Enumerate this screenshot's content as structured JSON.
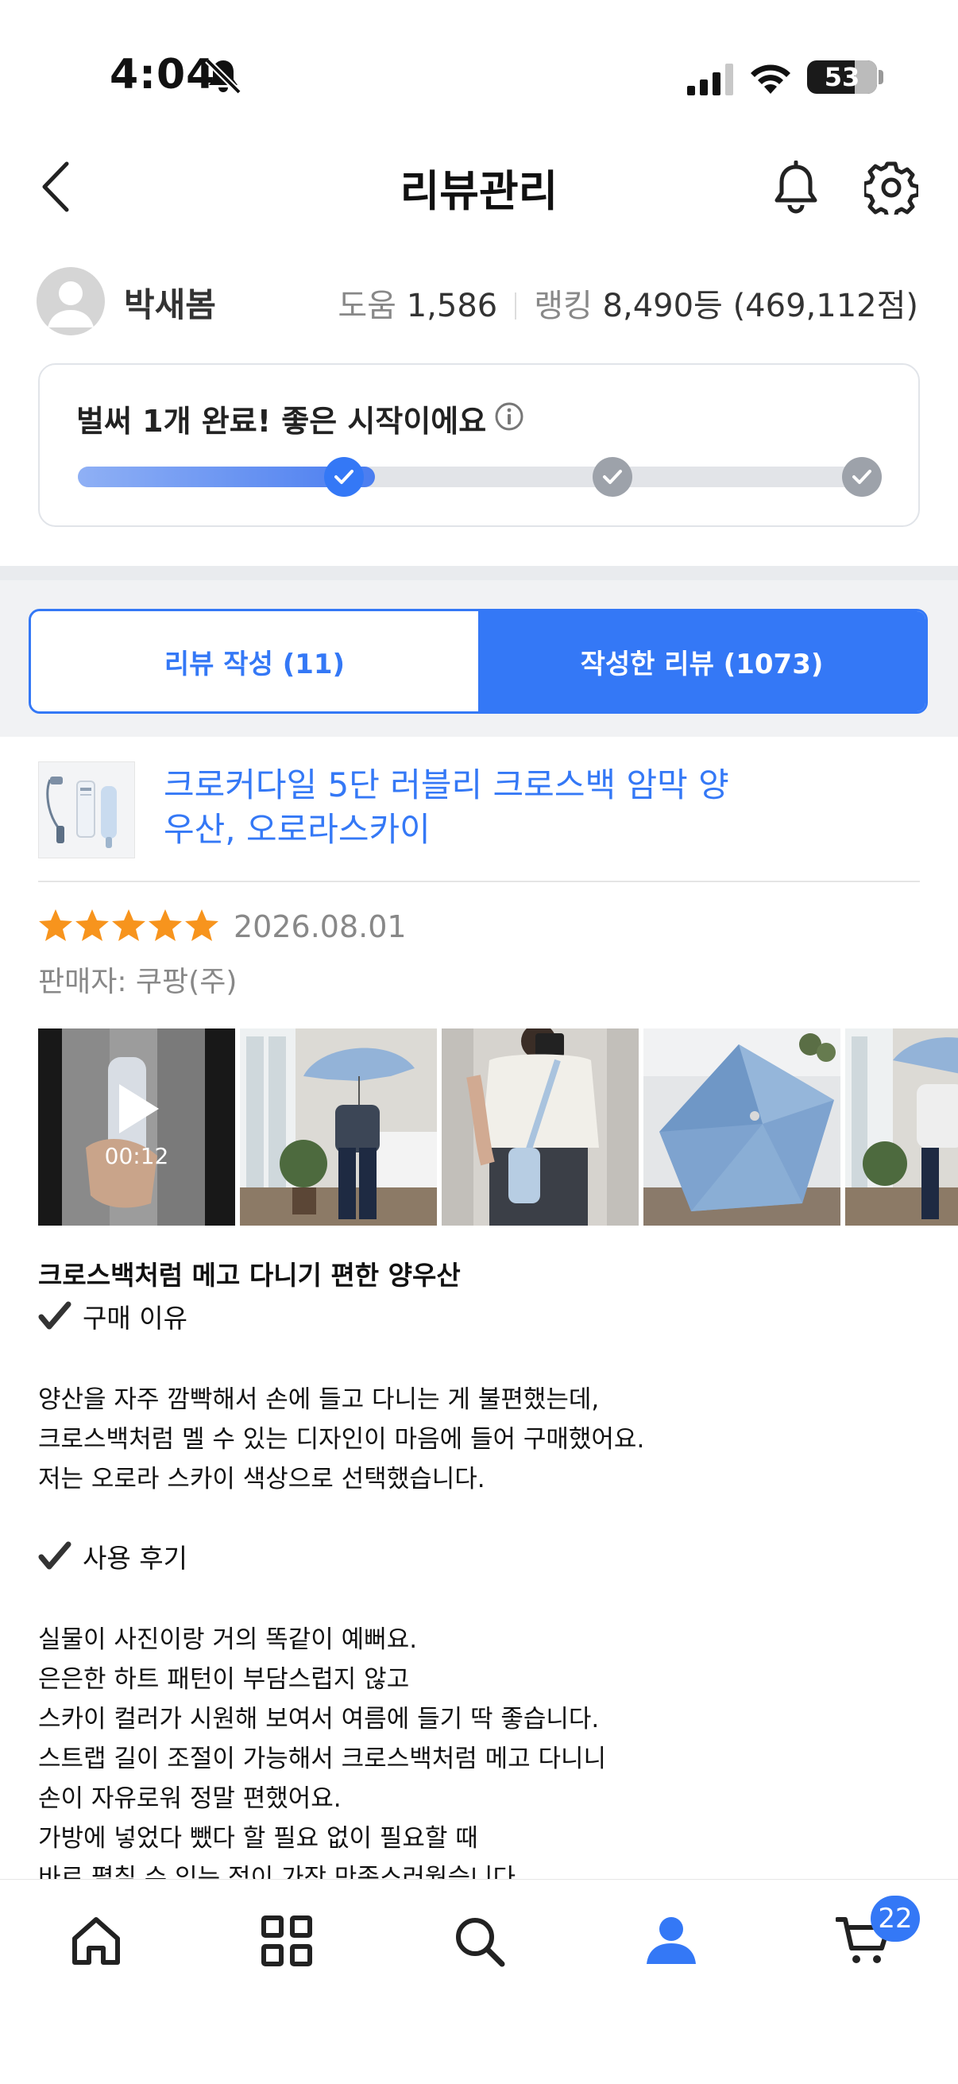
{
  "status_bar": {
    "time": "4:04",
    "battery": "53"
  },
  "header": {
    "title": "리뷰관리"
  },
  "profile": {
    "name": "박새봄",
    "help_label": "도움",
    "help_count": "1,586",
    "rank_label": "랭킹",
    "rank_value": "8,490등 (469,112점)"
  },
  "progress": {
    "message": "벌써 1개 완료! 좋은 시작이에요",
    "completed_steps": 1,
    "total_steps": 3,
    "fill_fraction": 0.37
  },
  "tabs": {
    "write": "리뷰 작성 (11)",
    "written": "작성한 리뷰 (1073)",
    "active": "written"
  },
  "review": {
    "product_name": "크로커다일 5단 러블리 크로스백 암막 양우산, 오로라스카이",
    "rating": 5,
    "date": "2026.08.01",
    "seller": "판매자: 쿠팡(주)",
    "video_duration": "00:12",
    "title": "크로스백처럼 메고 다니기 편한 양우산",
    "section1_heading": "구매 이유",
    "section1_lines": [
      "양산을 자주 깜빡해서 손에 들고 다니는 게 불편했는데,",
      "크로스백처럼 멜 수 있는 디자인이 마음에 들어 구매했어요.",
      "저는 오로라 스카이 색상으로 선택했습니다."
    ],
    "section2_heading": "사용 후기",
    "section2_lines": [
      "실물이 사진이랑 거의 똑같이 예뻐요.",
      "은은한 하트 패턴이 부담스럽지 않고",
      "스카이 컬러가 시원해 보여서 여름에 들기 딱 좋습니다.",
      "스트랩 길이 조절이 가능해서 크로스백처럼 메고 다니니",
      "손이 자유로워 정말 편했어요.",
      "가방에 넣었다 뺐다 할 필요 없이 필요할 때",
      "바로 펼칠 수 있는 점이 가장 만족스러웠습니다."
    ]
  },
  "bottom_nav": {
    "items": [
      "home-icon",
      "category-icon",
      "search-icon",
      "my-page-icon",
      "cart-icon"
    ],
    "active": "my-page-icon",
    "cart_badge": "22"
  },
  "colors": {
    "accent": "#3478f6",
    "star": "#f7941d",
    "muted": "#888888"
  }
}
